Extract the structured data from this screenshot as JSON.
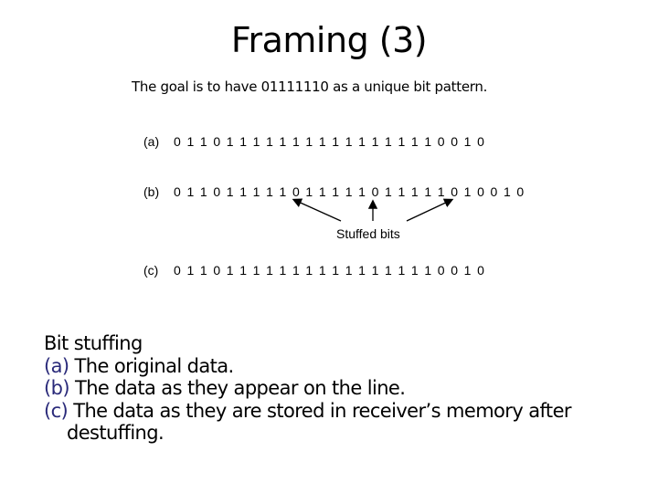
{
  "title": "Framing (3)",
  "goal": {
    "prefix": "The goal is to have ",
    "pattern": "01111110",
    "suffix": " as a unique bit pattern."
  },
  "figure": {
    "rows": [
      {
        "label": "(a)",
        "bits": "011011111111111111110010"
      },
      {
        "label": "(b)",
        "bits": "011011111011111011111010010"
      },
      {
        "label": "(c)",
        "bits": "011011111111111111110010"
      }
    ],
    "annotation": "Stuffed bits",
    "stuffed_bit_indices": [
      9,
      15,
      21
    ]
  },
  "caption": {
    "heading": "Bit stuffing",
    "items": [
      {
        "label": "(a)",
        "text": " The original data."
      },
      {
        "label": "(b)",
        "text": " The data as they appear on the line."
      },
      {
        "label": "(c)",
        "text": " The data as they are stored in receiver’s memory after"
      }
    ],
    "continuation": "destuffing."
  },
  "colors": {
    "label_color": "#2a2a7a"
  }
}
